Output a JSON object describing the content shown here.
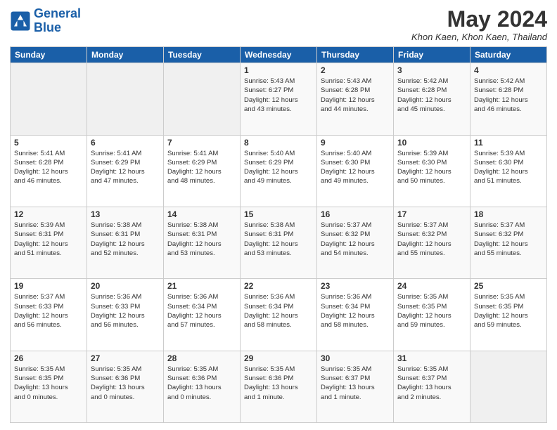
{
  "header": {
    "logo_line1": "General",
    "logo_line2": "Blue",
    "title": "May 2024",
    "location": "Khon Kaen, Khon Kaen, Thailand"
  },
  "weekdays": [
    "Sunday",
    "Monday",
    "Tuesday",
    "Wednesday",
    "Thursday",
    "Friday",
    "Saturday"
  ],
  "weeks": [
    [
      {
        "day": "",
        "info": ""
      },
      {
        "day": "",
        "info": ""
      },
      {
        "day": "",
        "info": ""
      },
      {
        "day": "1",
        "info": "Sunrise: 5:43 AM\nSunset: 6:27 PM\nDaylight: 12 hours\nand 43 minutes."
      },
      {
        "day": "2",
        "info": "Sunrise: 5:43 AM\nSunset: 6:28 PM\nDaylight: 12 hours\nand 44 minutes."
      },
      {
        "day": "3",
        "info": "Sunrise: 5:42 AM\nSunset: 6:28 PM\nDaylight: 12 hours\nand 45 minutes."
      },
      {
        "day": "4",
        "info": "Sunrise: 5:42 AM\nSunset: 6:28 PM\nDaylight: 12 hours\nand 46 minutes."
      }
    ],
    [
      {
        "day": "5",
        "info": "Sunrise: 5:41 AM\nSunset: 6:28 PM\nDaylight: 12 hours\nand 46 minutes."
      },
      {
        "day": "6",
        "info": "Sunrise: 5:41 AM\nSunset: 6:29 PM\nDaylight: 12 hours\nand 47 minutes."
      },
      {
        "day": "7",
        "info": "Sunrise: 5:41 AM\nSunset: 6:29 PM\nDaylight: 12 hours\nand 48 minutes."
      },
      {
        "day": "8",
        "info": "Sunrise: 5:40 AM\nSunset: 6:29 PM\nDaylight: 12 hours\nand 49 minutes."
      },
      {
        "day": "9",
        "info": "Sunrise: 5:40 AM\nSunset: 6:30 PM\nDaylight: 12 hours\nand 49 minutes."
      },
      {
        "day": "10",
        "info": "Sunrise: 5:39 AM\nSunset: 6:30 PM\nDaylight: 12 hours\nand 50 minutes."
      },
      {
        "day": "11",
        "info": "Sunrise: 5:39 AM\nSunset: 6:30 PM\nDaylight: 12 hours\nand 51 minutes."
      }
    ],
    [
      {
        "day": "12",
        "info": "Sunrise: 5:39 AM\nSunset: 6:31 PM\nDaylight: 12 hours\nand 51 minutes."
      },
      {
        "day": "13",
        "info": "Sunrise: 5:38 AM\nSunset: 6:31 PM\nDaylight: 12 hours\nand 52 minutes."
      },
      {
        "day": "14",
        "info": "Sunrise: 5:38 AM\nSunset: 6:31 PM\nDaylight: 12 hours\nand 53 minutes."
      },
      {
        "day": "15",
        "info": "Sunrise: 5:38 AM\nSunset: 6:31 PM\nDaylight: 12 hours\nand 53 minutes."
      },
      {
        "day": "16",
        "info": "Sunrise: 5:37 AM\nSunset: 6:32 PM\nDaylight: 12 hours\nand 54 minutes."
      },
      {
        "day": "17",
        "info": "Sunrise: 5:37 AM\nSunset: 6:32 PM\nDaylight: 12 hours\nand 55 minutes."
      },
      {
        "day": "18",
        "info": "Sunrise: 5:37 AM\nSunset: 6:32 PM\nDaylight: 12 hours\nand 55 minutes."
      }
    ],
    [
      {
        "day": "19",
        "info": "Sunrise: 5:37 AM\nSunset: 6:33 PM\nDaylight: 12 hours\nand 56 minutes."
      },
      {
        "day": "20",
        "info": "Sunrise: 5:36 AM\nSunset: 6:33 PM\nDaylight: 12 hours\nand 56 minutes."
      },
      {
        "day": "21",
        "info": "Sunrise: 5:36 AM\nSunset: 6:34 PM\nDaylight: 12 hours\nand 57 minutes."
      },
      {
        "day": "22",
        "info": "Sunrise: 5:36 AM\nSunset: 6:34 PM\nDaylight: 12 hours\nand 58 minutes."
      },
      {
        "day": "23",
        "info": "Sunrise: 5:36 AM\nSunset: 6:34 PM\nDaylight: 12 hours\nand 58 minutes."
      },
      {
        "day": "24",
        "info": "Sunrise: 5:35 AM\nSunset: 6:35 PM\nDaylight: 12 hours\nand 59 minutes."
      },
      {
        "day": "25",
        "info": "Sunrise: 5:35 AM\nSunset: 6:35 PM\nDaylight: 12 hours\nand 59 minutes."
      }
    ],
    [
      {
        "day": "26",
        "info": "Sunrise: 5:35 AM\nSunset: 6:35 PM\nDaylight: 13 hours\nand 0 minutes."
      },
      {
        "day": "27",
        "info": "Sunrise: 5:35 AM\nSunset: 6:36 PM\nDaylight: 13 hours\nand 0 minutes."
      },
      {
        "day": "28",
        "info": "Sunrise: 5:35 AM\nSunset: 6:36 PM\nDaylight: 13 hours\nand 0 minutes."
      },
      {
        "day": "29",
        "info": "Sunrise: 5:35 AM\nSunset: 6:36 PM\nDaylight: 13 hours\nand 1 minute."
      },
      {
        "day": "30",
        "info": "Sunrise: 5:35 AM\nSunset: 6:37 PM\nDaylight: 13 hours\nand 1 minute."
      },
      {
        "day": "31",
        "info": "Sunrise: 5:35 AM\nSunset: 6:37 PM\nDaylight: 13 hours\nand 2 minutes."
      },
      {
        "day": "",
        "info": ""
      }
    ]
  ]
}
